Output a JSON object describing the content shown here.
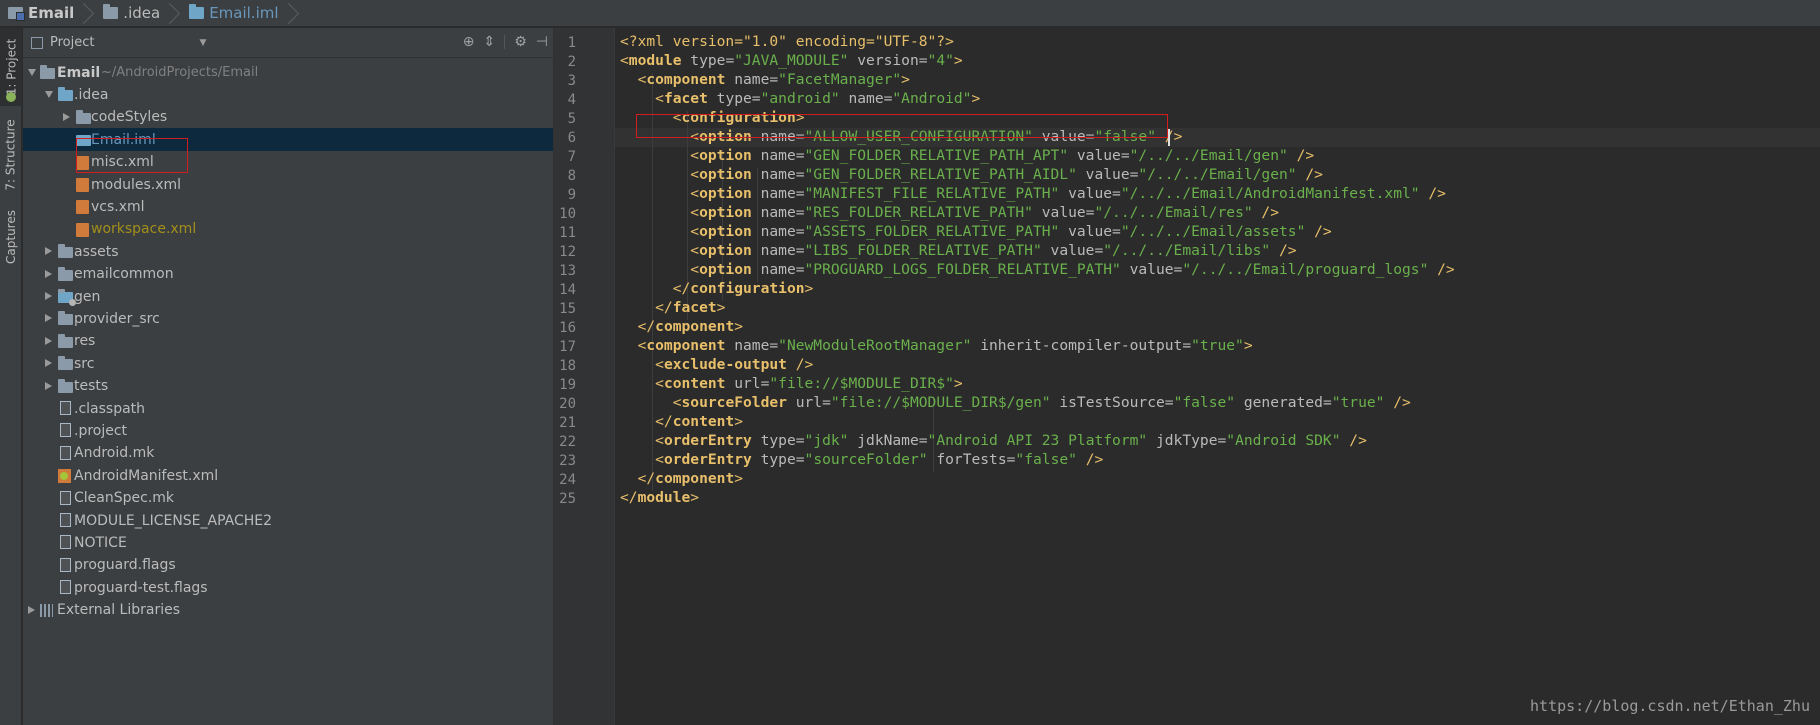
{
  "breadcrumb": [
    {
      "label": "Email",
      "icon": "module-icon"
    },
    {
      "label": ".idea",
      "icon": "folder-icon"
    },
    {
      "label": "Email.iml",
      "icon": "iml-file-icon"
    }
  ],
  "toolwindows": [
    {
      "label": "1: Project"
    },
    {
      "label": "7: Structure"
    },
    {
      "label": "Captures"
    }
  ],
  "project_panel": {
    "view_mode": "Project",
    "root_path": "~/AndroidProjects/Email",
    "tree": [
      {
        "label": "Email",
        "arrow": "open",
        "icon": "module",
        "indent": 0,
        "style": "bold",
        "suffix": "~/AndroidProjects/Email"
      },
      {
        "label": ".idea",
        "arrow": "open",
        "icon": "folder-blue",
        "indent": 1
      },
      {
        "label": "codeStyles",
        "arrow": "closed",
        "icon": "folder",
        "indent": 2
      },
      {
        "label": "Email.iml",
        "arrow": "",
        "icon": "iml",
        "indent": 2,
        "style": "blue",
        "selected": true
      },
      {
        "label": "misc.xml",
        "arrow": "",
        "icon": "xml",
        "indent": 2
      },
      {
        "label": "modules.xml",
        "arrow": "",
        "icon": "xml",
        "indent": 2
      },
      {
        "label": "vcs.xml",
        "arrow": "",
        "icon": "xml",
        "indent": 2
      },
      {
        "label": "workspace.xml",
        "arrow": "",
        "icon": "xml",
        "indent": 2,
        "style": "olive"
      },
      {
        "label": "assets",
        "arrow": "closed",
        "icon": "folder",
        "indent": 1
      },
      {
        "label": "emailcommon",
        "arrow": "closed",
        "icon": "folder",
        "indent": 1
      },
      {
        "label": "gen",
        "arrow": "closed",
        "icon": "gen",
        "indent": 1
      },
      {
        "label": "provider_src",
        "arrow": "closed",
        "icon": "folder",
        "indent": 1
      },
      {
        "label": "res",
        "arrow": "closed",
        "icon": "folder",
        "indent": 1
      },
      {
        "label": "src",
        "arrow": "closed",
        "icon": "folder",
        "indent": 1
      },
      {
        "label": "tests",
        "arrow": "closed",
        "icon": "folder",
        "indent": 1
      },
      {
        "label": ".classpath",
        "arrow": "",
        "icon": "file",
        "indent": 1
      },
      {
        "label": ".project",
        "arrow": "",
        "icon": "file",
        "indent": 1
      },
      {
        "label": "Android.mk",
        "arrow": "",
        "icon": "file",
        "indent": 1
      },
      {
        "label": "AndroidManifest.xml",
        "arrow": "",
        "icon": "manifest",
        "indent": 1
      },
      {
        "label": "CleanSpec.mk",
        "arrow": "",
        "icon": "file",
        "indent": 1
      },
      {
        "label": "MODULE_LICENSE_APACHE2",
        "arrow": "",
        "icon": "file",
        "indent": 1
      },
      {
        "label": "NOTICE",
        "arrow": "",
        "icon": "file",
        "indent": 1
      },
      {
        "label": "proguard.flags",
        "arrow": "",
        "icon": "file",
        "indent": 1
      },
      {
        "label": "proguard-test.flags",
        "arrow": "",
        "icon": "file",
        "indent": 1
      },
      {
        "label": "External Libraries",
        "arrow": "closed",
        "icon": "libs",
        "indent": 0
      }
    ]
  },
  "editor": {
    "current_line": 6,
    "lines": [
      [
        {
          "t": "<?xml version=\"1.0\" encoding=\"UTF-8\"?>",
          "k": "pi"
        }
      ],
      [
        {
          "t": "<",
          "k": "br"
        },
        {
          "t": "module",
          "k": "tag"
        },
        {
          "t": " type=",
          "k": "attr"
        },
        {
          "t": "\"JAVA_MODULE\"",
          "k": "val"
        },
        {
          "t": " version=",
          "k": "attr"
        },
        {
          "t": "\"4\"",
          "k": "val"
        },
        {
          "t": ">",
          "k": "br"
        }
      ],
      [
        {
          "t": "  <",
          "k": "br"
        },
        {
          "t": "component",
          "k": "tag"
        },
        {
          "t": " name=",
          "k": "attr"
        },
        {
          "t": "\"FacetManager\"",
          "k": "val"
        },
        {
          "t": ">",
          "k": "br"
        }
      ],
      [
        {
          "t": "    <",
          "k": "br"
        },
        {
          "t": "facet",
          "k": "tag"
        },
        {
          "t": " type=",
          "k": "attr"
        },
        {
          "t": "\"android\"",
          "k": "val"
        },
        {
          "t": " name=",
          "k": "attr"
        },
        {
          "t": "\"Android\"",
          "k": "val"
        },
        {
          "t": ">",
          "k": "br"
        }
      ],
      [
        {
          "t": "      <",
          "k": "br"
        },
        {
          "t": "configuration",
          "k": "tag"
        },
        {
          "t": ">",
          "k": "br"
        }
      ],
      [
        {
          "t": "        <",
          "k": "br"
        },
        {
          "t": "option",
          "k": "tag"
        },
        {
          "t": " name=",
          "k": "attr"
        },
        {
          "t": "\"ALLOW_USER_CONFIGURATION\"",
          "k": "val"
        },
        {
          "t": " value=",
          "k": "attr"
        },
        {
          "t": "\"false\"",
          "k": "val"
        },
        {
          "t": " />",
          "k": "br"
        }
      ],
      [
        {
          "t": "        <",
          "k": "br"
        },
        {
          "t": "option",
          "k": "tag"
        },
        {
          "t": " name=",
          "k": "attr"
        },
        {
          "t": "\"GEN_FOLDER_RELATIVE_PATH_APT\"",
          "k": "val"
        },
        {
          "t": " value=",
          "k": "attr"
        },
        {
          "t": "\"/../../Email/gen\"",
          "k": "val"
        },
        {
          "t": " />",
          "k": "br"
        }
      ],
      [
        {
          "t": "        <",
          "k": "br"
        },
        {
          "t": "option",
          "k": "tag"
        },
        {
          "t": " name=",
          "k": "attr"
        },
        {
          "t": "\"GEN_FOLDER_RELATIVE_PATH_AIDL\"",
          "k": "val"
        },
        {
          "t": " value=",
          "k": "attr"
        },
        {
          "t": "\"/../../Email/gen\"",
          "k": "val"
        },
        {
          "t": " />",
          "k": "br"
        }
      ],
      [
        {
          "t": "        <",
          "k": "br"
        },
        {
          "t": "option",
          "k": "tag"
        },
        {
          "t": " name=",
          "k": "attr"
        },
        {
          "t": "\"MANIFEST_FILE_RELATIVE_PATH\"",
          "k": "val"
        },
        {
          "t": " value=",
          "k": "attr"
        },
        {
          "t": "\"/../../Email/AndroidManifest.xml\"",
          "k": "val"
        },
        {
          "t": " />",
          "k": "br"
        }
      ],
      [
        {
          "t": "        <",
          "k": "br"
        },
        {
          "t": "option",
          "k": "tag"
        },
        {
          "t": " name=",
          "k": "attr"
        },
        {
          "t": "\"RES_FOLDER_RELATIVE_PATH\"",
          "k": "val"
        },
        {
          "t": " value=",
          "k": "attr"
        },
        {
          "t": "\"/../../Email/res\"",
          "k": "val"
        },
        {
          "t": " />",
          "k": "br"
        }
      ],
      [
        {
          "t": "        <",
          "k": "br"
        },
        {
          "t": "option",
          "k": "tag"
        },
        {
          "t": " name=",
          "k": "attr"
        },
        {
          "t": "\"ASSETS_FOLDER_RELATIVE_PATH\"",
          "k": "val"
        },
        {
          "t": " value=",
          "k": "attr"
        },
        {
          "t": "\"/../../Email/assets\"",
          "k": "val"
        },
        {
          "t": " />",
          "k": "br"
        }
      ],
      [
        {
          "t": "        <",
          "k": "br"
        },
        {
          "t": "option",
          "k": "tag"
        },
        {
          "t": " name=",
          "k": "attr"
        },
        {
          "t": "\"LIBS_FOLDER_RELATIVE_PATH\"",
          "k": "val"
        },
        {
          "t": " value=",
          "k": "attr"
        },
        {
          "t": "\"/../../Email/libs\"",
          "k": "val"
        },
        {
          "t": " />",
          "k": "br"
        }
      ],
      [
        {
          "t": "        <",
          "k": "br"
        },
        {
          "t": "option",
          "k": "tag"
        },
        {
          "t": " name=",
          "k": "attr"
        },
        {
          "t": "\"PROGUARD_LOGS_FOLDER_RELATIVE_PATH\"",
          "k": "val"
        },
        {
          "t": " value=",
          "k": "attr"
        },
        {
          "t": "\"/../../Email/proguard_logs\"",
          "k": "val"
        },
        {
          "t": " />",
          "k": "br"
        }
      ],
      [
        {
          "t": "      </",
          "k": "br"
        },
        {
          "t": "configuration",
          "k": "tag"
        },
        {
          "t": ">",
          "k": "br"
        }
      ],
      [
        {
          "t": "    </",
          "k": "br"
        },
        {
          "t": "facet",
          "k": "tag"
        },
        {
          "t": ">",
          "k": "br"
        }
      ],
      [
        {
          "t": "  </",
          "k": "br"
        },
        {
          "t": "component",
          "k": "tag"
        },
        {
          "t": ">",
          "k": "br"
        }
      ],
      [
        {
          "t": "  <",
          "k": "br"
        },
        {
          "t": "component",
          "k": "tag"
        },
        {
          "t": " name=",
          "k": "attr"
        },
        {
          "t": "\"NewModuleRootManager\"",
          "k": "val"
        },
        {
          "t": " inherit-compiler-output=",
          "k": "attr"
        },
        {
          "t": "\"true\"",
          "k": "val"
        },
        {
          "t": ">",
          "k": "br"
        }
      ],
      [
        {
          "t": "    <",
          "k": "br"
        },
        {
          "t": "exclude-output",
          "k": "tag"
        },
        {
          "t": " />",
          "k": "br"
        }
      ],
      [
        {
          "t": "    <",
          "k": "br"
        },
        {
          "t": "content",
          "k": "tag"
        },
        {
          "t": " url=",
          "k": "attr"
        },
        {
          "t": "\"file://$MODULE_DIR$\"",
          "k": "val"
        },
        {
          "t": ">",
          "k": "br"
        }
      ],
      [
        {
          "t": "      <",
          "k": "br"
        },
        {
          "t": "sourceFolder",
          "k": "tag"
        },
        {
          "t": " url=",
          "k": "attr"
        },
        {
          "t": "\"file://$MODULE_DIR$/gen\"",
          "k": "val"
        },
        {
          "t": " isTestSource=",
          "k": "attr"
        },
        {
          "t": "\"false\"",
          "k": "val"
        },
        {
          "t": " generated=",
          "k": "attr"
        },
        {
          "t": "\"true\"",
          "k": "val"
        },
        {
          "t": " />",
          "k": "br"
        }
      ],
      [
        {
          "t": "    </",
          "k": "br"
        },
        {
          "t": "content",
          "k": "tag"
        },
        {
          "t": ">",
          "k": "br"
        }
      ],
      [
        {
          "t": "    <",
          "k": "br"
        },
        {
          "t": "orderEntry",
          "k": "tag"
        },
        {
          "t": " type=",
          "k": "attr"
        },
        {
          "t": "\"jdk\"",
          "k": "val"
        },
        {
          "t": " jdkName=",
          "k": "attr"
        },
        {
          "t": "\"Android API 23 Platform\"",
          "k": "val"
        },
        {
          "t": " jdkType=",
          "k": "attr"
        },
        {
          "t": "\"Android SDK\"",
          "k": "val"
        },
        {
          "t": " />",
          "k": "br"
        }
      ],
      [
        {
          "t": "    <",
          "k": "br"
        },
        {
          "t": "orderEntry",
          "k": "tag"
        },
        {
          "t": " type=",
          "k": "attr"
        },
        {
          "t": "\"sourceFolder\"",
          "k": "val"
        },
        {
          "t": " forTests=",
          "k": "attr"
        },
        {
          "t": "\"false\"",
          "k": "val"
        },
        {
          "t": " />",
          "k": "br"
        }
      ],
      [
        {
          "t": "  </",
          "k": "br"
        },
        {
          "t": "component",
          "k": "tag"
        },
        {
          "t": ">",
          "k": "br"
        }
      ],
      [
        {
          "t": "</",
          "k": "br"
        },
        {
          "t": "module",
          "k": "tag"
        },
        {
          "t": ">",
          "k": "br"
        }
      ]
    ]
  },
  "watermark": "https://blog.csdn.net/Ethan_Zhu",
  "colors": {
    "tag": "#e8bf6a",
    "attribute": "#bababa",
    "value": "#6ab04c",
    "highlight_box": "#d11d1d",
    "selection": "#0d293e"
  }
}
